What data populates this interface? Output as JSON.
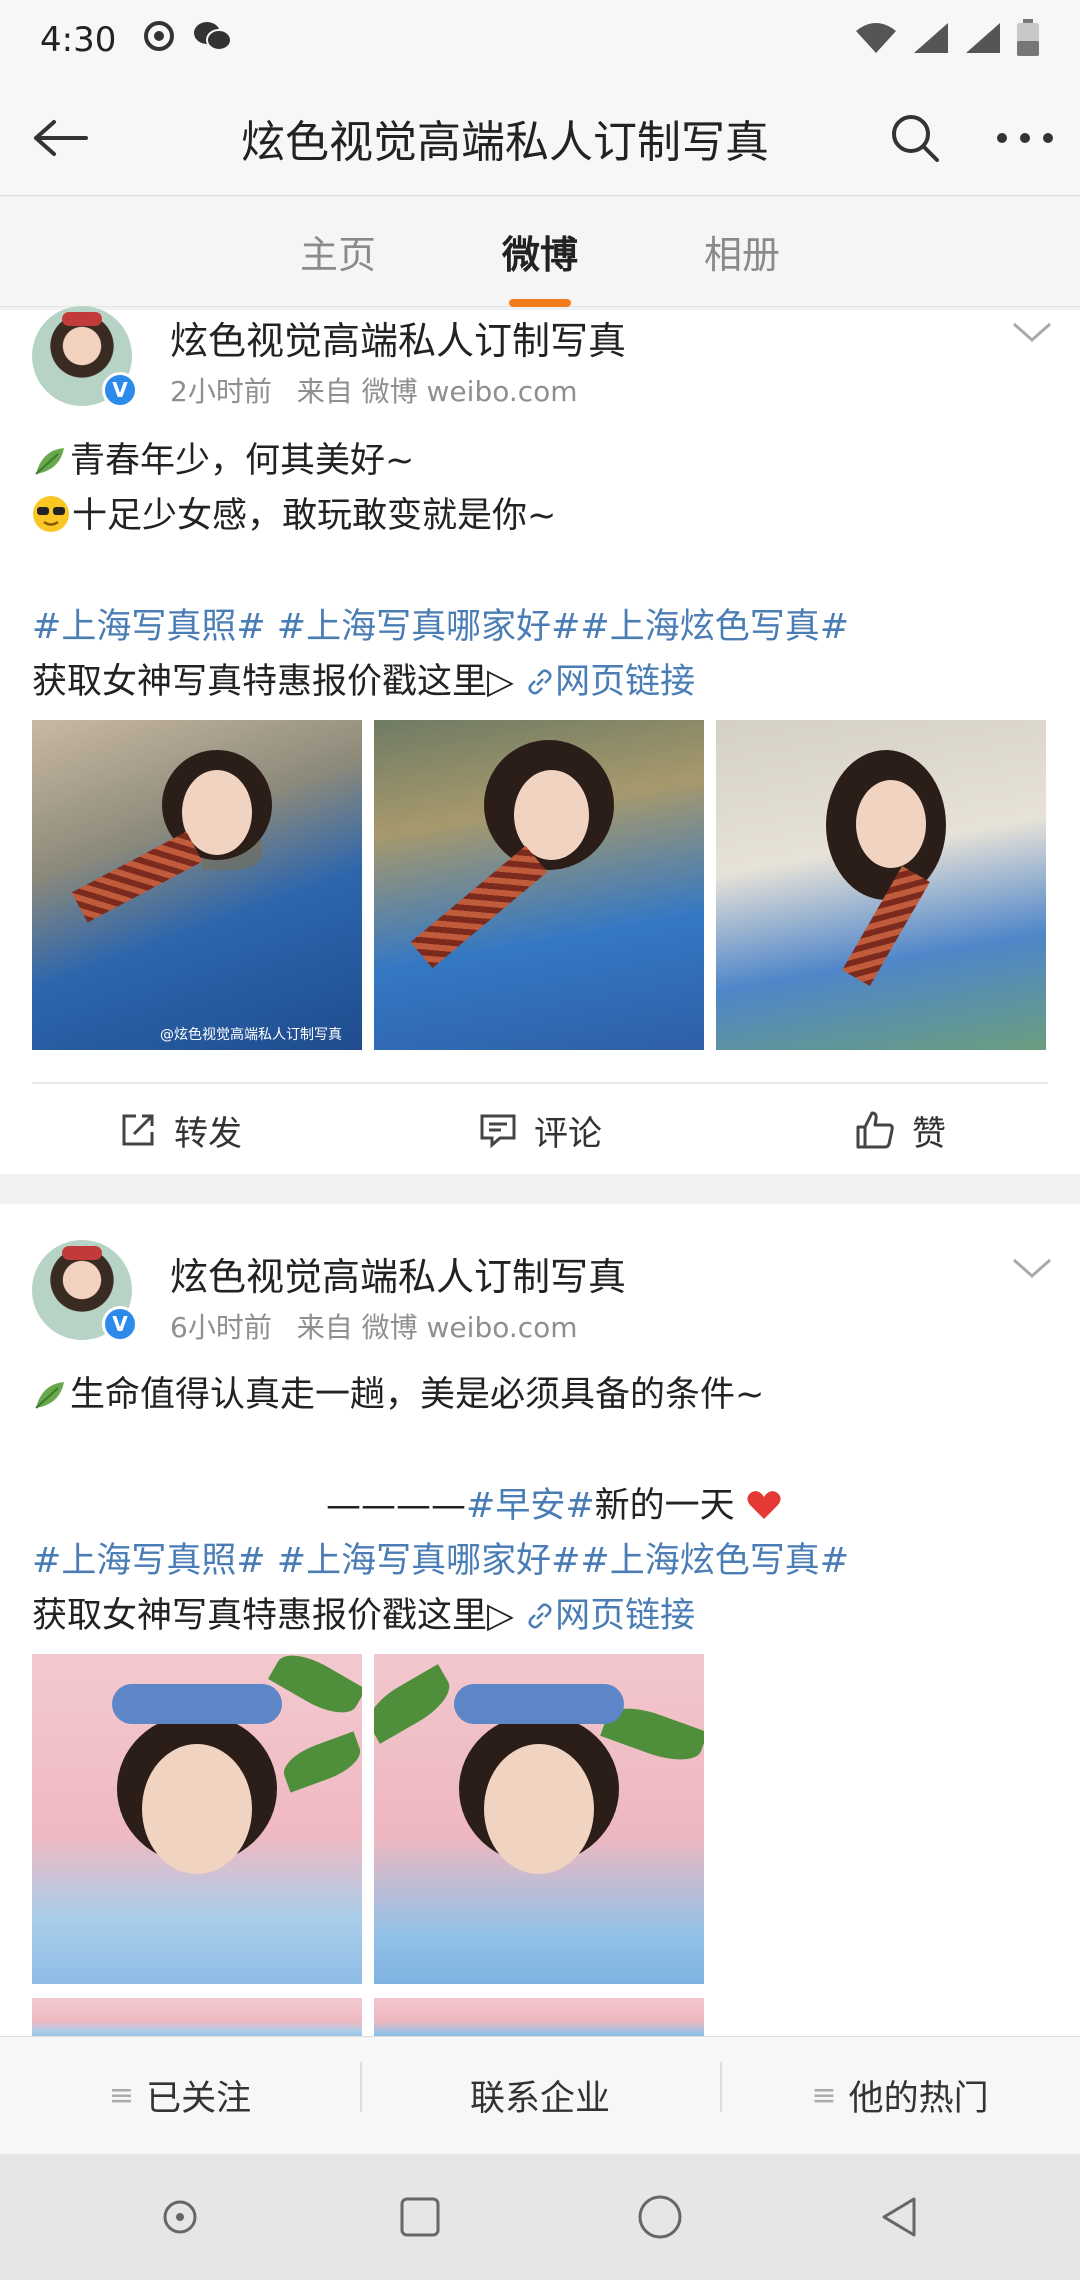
{
  "status_bar": {
    "time": "4:30"
  },
  "header": {
    "title": "炫色视觉高端私人订制写真"
  },
  "tabs": [
    {
      "label": "主页",
      "active": false
    },
    {
      "label": "微博",
      "active": true
    },
    {
      "label": "相册",
      "active": false
    }
  ],
  "posts": [
    {
      "author": "炫色视觉高端私人订制写真",
      "time": "2小时前",
      "source": "来自 微博 weibo.com",
      "lines": [
        "青春年少，何其美好~",
        "十足少女感，敢玩敢变就是你~"
      ],
      "topics": "#上海写真照# #上海写真哪家好##上海炫色写真#",
      "cta_text": "获取女神写真特惠报价戳这里▷",
      "link_label": "网页链接",
      "watermark": "@炫色视觉高端私人订制写真",
      "actions": {
        "repost": "转发",
        "comment": "评论",
        "like": "赞"
      }
    },
    {
      "author": "炫色视觉高端私人订制写真",
      "time": "6小时前",
      "source": "来自 微博 weibo.com",
      "line1": "生命值得认真走一趟，美是必须具备的条件~",
      "dash_line_prefix": "————",
      "dash_line_topic": "#早安#",
      "dash_line_suffix": "新的一天",
      "topics": "#上海写真照# #上海写真哪家好##上海炫色写真#",
      "cta_text": "获取女神写真特惠报价戳这里▷",
      "link_label": "网页链接"
    }
  ],
  "bottom_bar": {
    "following": "已关注",
    "contact": "联系企业",
    "hot": "他的热门"
  },
  "colors": {
    "accent_orange": "#f27c1c",
    "link_blue": "#4a7db5",
    "verified_blue": "#2c8bea",
    "heart_red": "#e53935"
  }
}
